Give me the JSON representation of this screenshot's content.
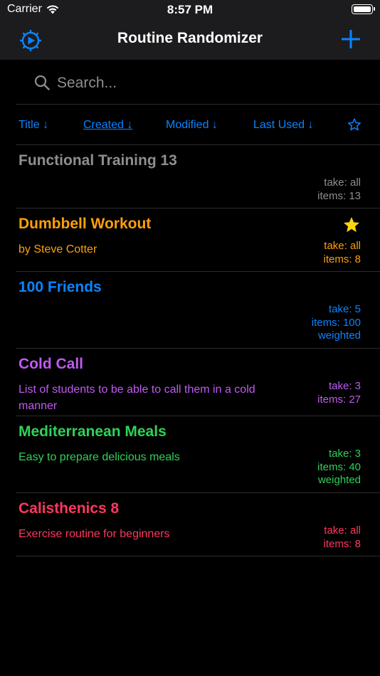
{
  "status": {
    "carrier": "Carrier",
    "time": "8:57 PM"
  },
  "nav": {
    "title": "Routine Randomizer"
  },
  "search": {
    "placeholder": "Search..."
  },
  "sort": {
    "title": "Title ↓",
    "created": "Created ↓",
    "modified": "Modified ↓",
    "last_used": "Last Used ↓"
  },
  "colors": {
    "accent": "#0a84ff",
    "gray": "#8e8e93",
    "orange": "#ff9f0a",
    "blue": "#0a84ff",
    "purple": "#bf5af2",
    "green": "#30d158",
    "red": "#ff375f",
    "star": "#ffd60a"
  },
  "routines": [
    {
      "title": "Functional Training 13",
      "description": "",
      "take": "take: all",
      "items": "items: 13",
      "extra": "",
      "color": "#8e8e93",
      "favorite": false
    },
    {
      "title": "Dumbbell Workout",
      "description": "by Steve Cotter",
      "take": "take: all",
      "items": "items: 8",
      "extra": "",
      "color": "#ff9f0a",
      "favorite": true
    },
    {
      "title": "100 Friends",
      "description": "",
      "take": "take: 5",
      "items": "items: 100",
      "extra": "weighted",
      "color": "#0a84ff",
      "favorite": false
    },
    {
      "title": "Cold Call",
      "description": "List of students to be able to call them in a cold manner",
      "take": "take: 3",
      "items": "items: 27",
      "extra": "",
      "color": "#bf5af2",
      "favorite": false
    },
    {
      "title": "Mediterranean Meals",
      "description": "Easy to prepare delicious meals",
      "take": "take: 3",
      "items": "items: 40",
      "extra": "weighted",
      "color": "#30d158",
      "favorite": false
    },
    {
      "title": "Calisthenics 8",
      "description": "Exercise routine for beginners",
      "take": "take: all",
      "items": "items: 8",
      "extra": "",
      "color": "#ff375f",
      "favorite": false
    }
  ]
}
